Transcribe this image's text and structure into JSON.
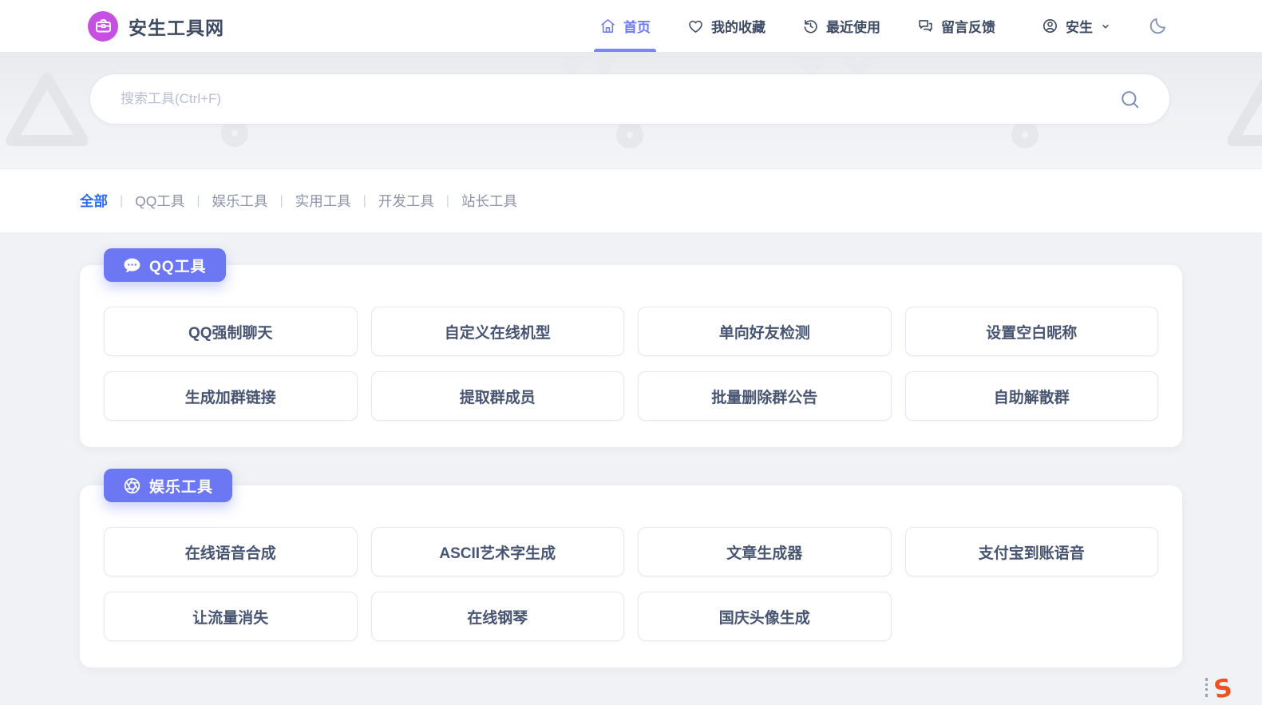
{
  "brand": {
    "title": "安生工具网",
    "logo_icon": "toolbox-icon",
    "logo_color": "#c44fe0"
  },
  "nav": {
    "items": [
      {
        "name": "home",
        "label": "首页",
        "icon": "home-icon",
        "active": true
      },
      {
        "name": "favorites",
        "label": "我的收藏",
        "icon": "heart-icon",
        "active": false
      },
      {
        "name": "recent",
        "label": "最近使用",
        "icon": "history-icon",
        "active": false
      },
      {
        "name": "feedback",
        "label": "留言反馈",
        "icon": "feedback-icon",
        "active": false
      }
    ],
    "user": {
      "label": "安生",
      "icon": "user-icon",
      "chevron_icon": "chevron-down-icon"
    },
    "theme_toggle_icon": "moon-icon"
  },
  "search": {
    "placeholder": "搜索工具(Ctrl+F)",
    "icon": "search-icon"
  },
  "filters": {
    "separator": "|",
    "items": [
      {
        "name": "all",
        "label": "全部",
        "active": true
      },
      {
        "name": "qq-tools",
        "label": "QQ工具",
        "active": false
      },
      {
        "name": "entertainment-tools",
        "label": "娱乐工具",
        "active": false
      },
      {
        "name": "utility-tools",
        "label": "实用工具",
        "active": false
      },
      {
        "name": "dev-tools",
        "label": "开发工具",
        "active": false
      },
      {
        "name": "webmaster-tools",
        "label": "站长工具",
        "active": false
      }
    ]
  },
  "sections": [
    {
      "name": "qq-tools",
      "title": "QQ工具",
      "icon": "chat-bubble-icon",
      "tools": [
        "QQ强制聊天",
        "自定义在线机型",
        "单向好友检测",
        "设置空白昵称",
        "生成加群链接",
        "提取群成员",
        "批量删除群公告",
        "自助解散群"
      ]
    },
    {
      "name": "entertainment-tools",
      "title": "娱乐工具",
      "icon": "aperture-icon",
      "tools": [
        "在线语音合成",
        "ASCII艺术字生成",
        "文章生成器",
        "支付宝到账语音",
        "让流量消失",
        "在线钢琴",
        "国庆头像生成"
      ]
    }
  ],
  "watermark": {
    "label": "S",
    "color": "#f05123"
  },
  "colors": {
    "accent_periwinkle": "#6b77f3",
    "active_nav": "#6e7af7",
    "link_blue": "#2b6af5",
    "brand_purple": "#c44fe0",
    "text_dark": "#3d4a64",
    "button_text": "#485572",
    "placeholder": "#b8bfd3"
  }
}
